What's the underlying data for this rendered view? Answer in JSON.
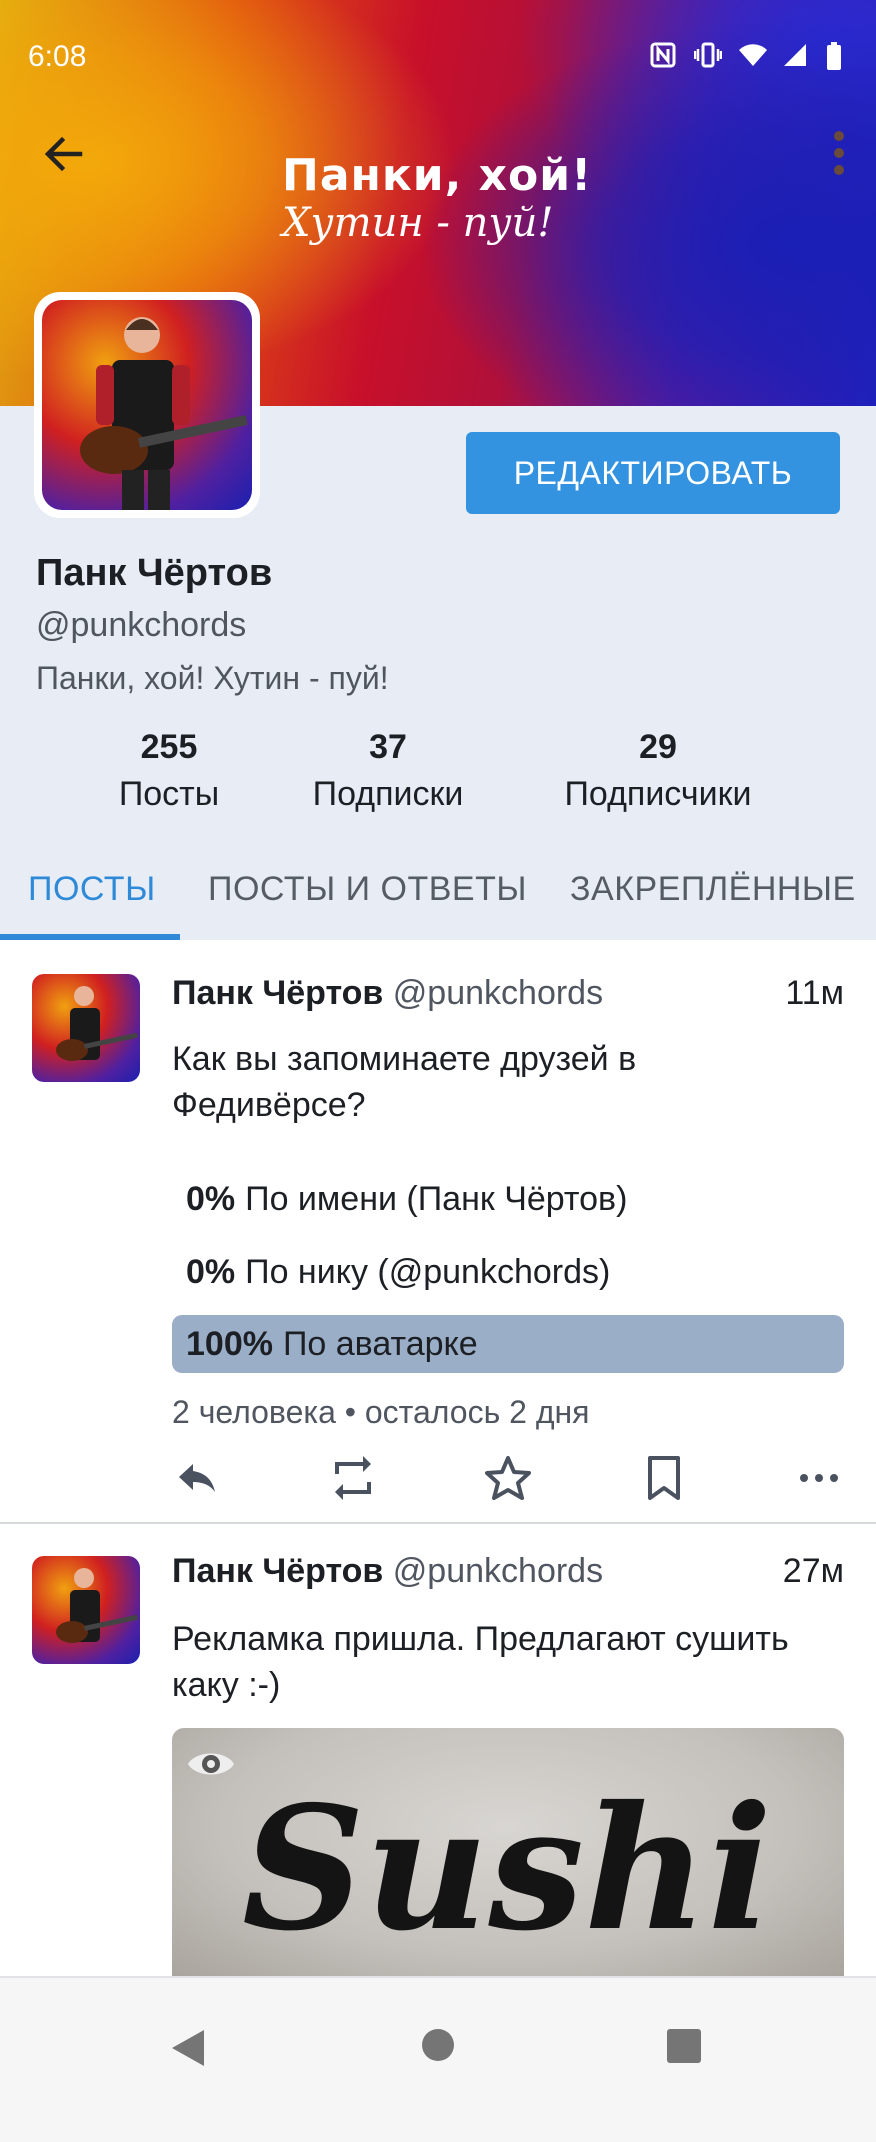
{
  "status": {
    "time": "6:08"
  },
  "banner": {
    "title": "Панки, хой!",
    "subtitle": "Хутин - пуй!"
  },
  "profile": {
    "edit_label": "РЕДАКТИРОВАТЬ",
    "name": "Панк Чёртов",
    "handle": "@punkchords",
    "bio": "Панки, хой! Хутин - пуй!",
    "stats": [
      {
        "value": "255",
        "label": "Посты"
      },
      {
        "value": "37",
        "label": "Подписки"
      },
      {
        "value": "29",
        "label": "Подписчики"
      }
    ]
  },
  "tabs": [
    {
      "label": "ПОСТЫ",
      "active": true
    },
    {
      "label": "ПОСТЫ И ОТВЕТЫ",
      "active": false
    },
    {
      "label": "ЗАКРЕПЛЁННЫЕ",
      "active": false
    }
  ],
  "posts": [
    {
      "author": "Панк Чёртов",
      "handle": "@punkchords",
      "time": "11м",
      "text": "Как вы запоминаете друзей в Федивёрсе?",
      "poll": {
        "options": [
          {
            "percent": "0%",
            "label": "По имени (Панк Чёртов)"
          },
          {
            "percent": "0%",
            "label": "По нику (@punkchords)"
          },
          {
            "percent": "100%",
            "label": "По аватарке"
          }
        ],
        "meta": "2 человека • осталось 2 дня"
      }
    },
    {
      "author": "Панк Чёртов",
      "handle": "@punkchords",
      "time": "27м",
      "text": "Рекламка пришла. Предлагают сушить каку :-)",
      "image_text": "Sushi"
    }
  ],
  "colors": {
    "accent": "#2e8ad8",
    "button": "#3393e0",
    "profile_bg": "#e8edf5",
    "poll_winner": "#9aaec8"
  }
}
